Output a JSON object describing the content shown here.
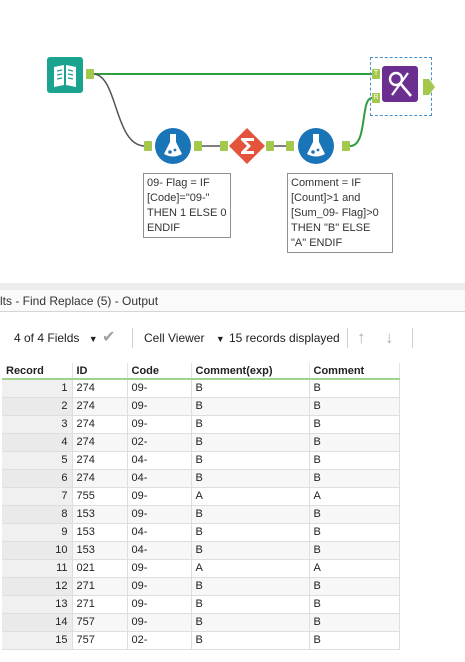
{
  "workflow": {
    "formula1_annotation": "09- Flag = IF\n[Code]=\"09-\"\nTHEN 1 ELSE 0\nENDIF",
    "formula2_annotation": "Comment = IF\n[Count]>1 and\n[Sum_09- Flag]>0\nTHEN \"B\" ELSE\n\"A\" ENDIF",
    "anchor_t": "T",
    "anchor_r": "R",
    "colors": {
      "input": "#1aa38f",
      "formula": "#1a74b8",
      "summarize": "#e4533b",
      "findreplace": "#6b2f8f",
      "connector": "#2f9e3e"
    }
  },
  "results": {
    "title": "lts - Find Replace (5) - Output",
    "fields_label": "4 of 4 Fields",
    "viewer_label": "Cell Viewer",
    "records_label": "15 records displayed",
    "columns": [
      "Record",
      "ID",
      "Code",
      "Comment(exp)",
      "Comment"
    ],
    "rows": [
      [
        "1",
        "274",
        "09-",
        "B",
        "B"
      ],
      [
        "2",
        "274",
        "09-",
        "B",
        "B"
      ],
      [
        "3",
        "274",
        "09-",
        "B",
        "B"
      ],
      [
        "4",
        "274",
        "02-",
        "B",
        "B"
      ],
      [
        "5",
        "274",
        "04-",
        "B",
        "B"
      ],
      [
        "6",
        "274",
        "04-",
        "B",
        "B"
      ],
      [
        "7",
        "755",
        "09-",
        "A",
        "A"
      ],
      [
        "8",
        "153",
        "09-",
        "B",
        "B"
      ],
      [
        "9",
        "153",
        "04-",
        "B",
        "B"
      ],
      [
        "10",
        "153",
        "04-",
        "B",
        "B"
      ],
      [
        "11",
        "021",
        "09-",
        "A",
        "A"
      ],
      [
        "12",
        "271",
        "09-",
        "B",
        "B"
      ],
      [
        "13",
        "271",
        "09-",
        "B",
        "B"
      ],
      [
        "14",
        "757",
        "09-",
        "B",
        "B"
      ],
      [
        "15",
        "757",
        "02-",
        "B",
        "B"
      ]
    ]
  }
}
